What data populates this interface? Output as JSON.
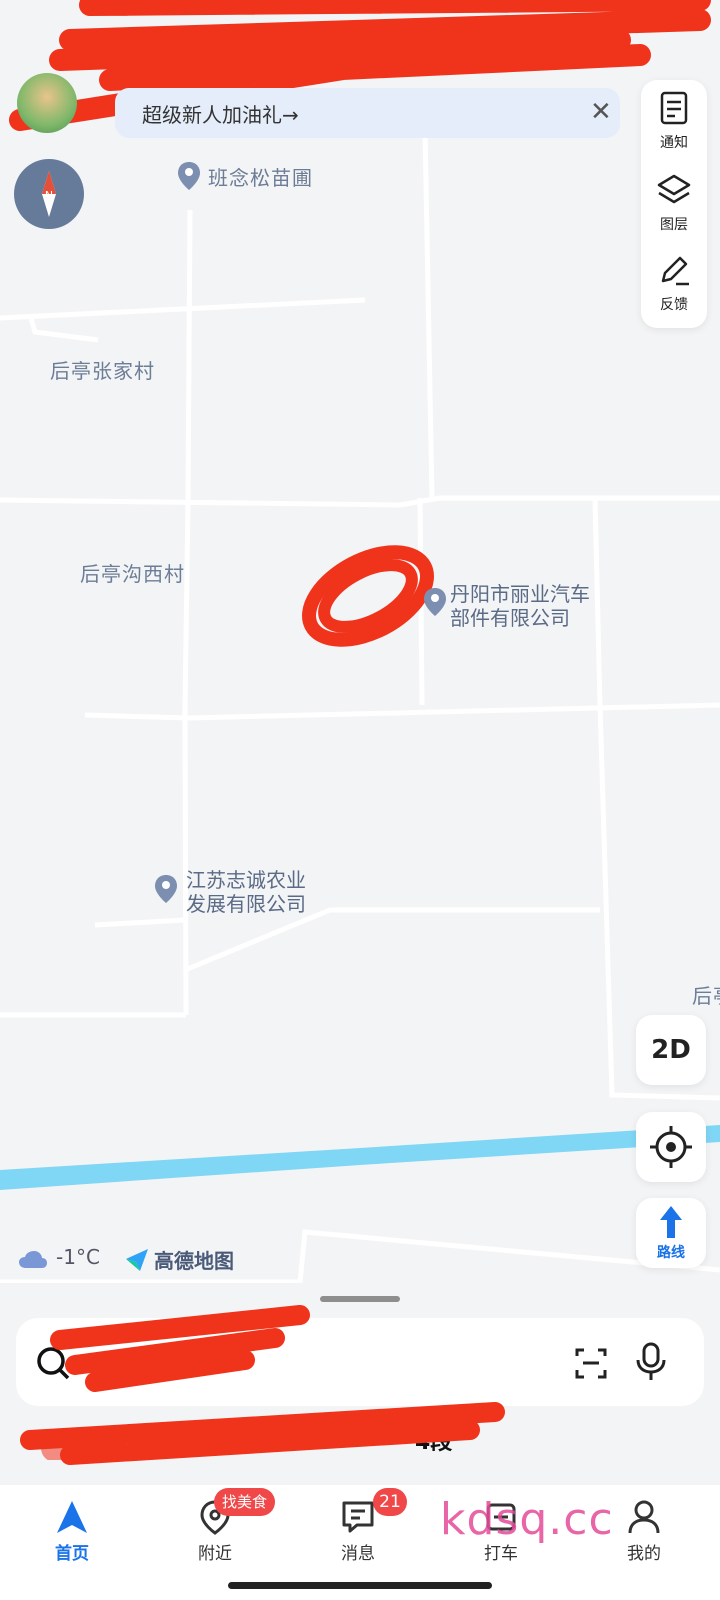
{
  "promo": {
    "text": "超级新人加油礼→",
    "close": "✕"
  },
  "toolbar": [
    {
      "name": "notice",
      "label": "通知",
      "icon": "document-icon"
    },
    {
      "name": "layers",
      "label": "图层",
      "icon": "layers-icon"
    },
    {
      "name": "feedback",
      "label": "反馈",
      "icon": "pencil-icon"
    }
  ],
  "map": {
    "labels": [
      "班念松苗圃",
      "后亭张家村",
      "后亭沟西村",
      "后亭"
    ],
    "pois": [
      {
        "line1": "丹阳市丽业汽车",
        "line2": "部件有限公司"
      },
      {
        "line1": "江苏志诚农业",
        "line2": "发展有限公司"
      }
    ]
  },
  "controls": {
    "mode": "2D",
    "route": "路线"
  },
  "weather": {
    "temp": "-1°C",
    "icon": "cloud-icon"
  },
  "brand": "高德地图",
  "recent_suffix": "4段",
  "tabs": [
    {
      "name": "home",
      "label": "首页",
      "icon": "navigation-arrow-icon",
      "active": true
    },
    {
      "name": "nearby",
      "label": "附近",
      "icon": "location-pin-icon",
      "badge": "找美食"
    },
    {
      "name": "messages",
      "label": "消息",
      "icon": "chat-icon",
      "badge": "21"
    },
    {
      "name": "taxi",
      "label": "打车",
      "icon": "taxi-icon"
    },
    {
      "name": "mine",
      "label": "我的",
      "icon": "person-icon"
    }
  ],
  "watermark": "kdsq.cc",
  "colors": {
    "accent": "#1a73e8",
    "river": "#7fd6f5",
    "badge": "#f04848",
    "redaction": "#f0341c"
  }
}
